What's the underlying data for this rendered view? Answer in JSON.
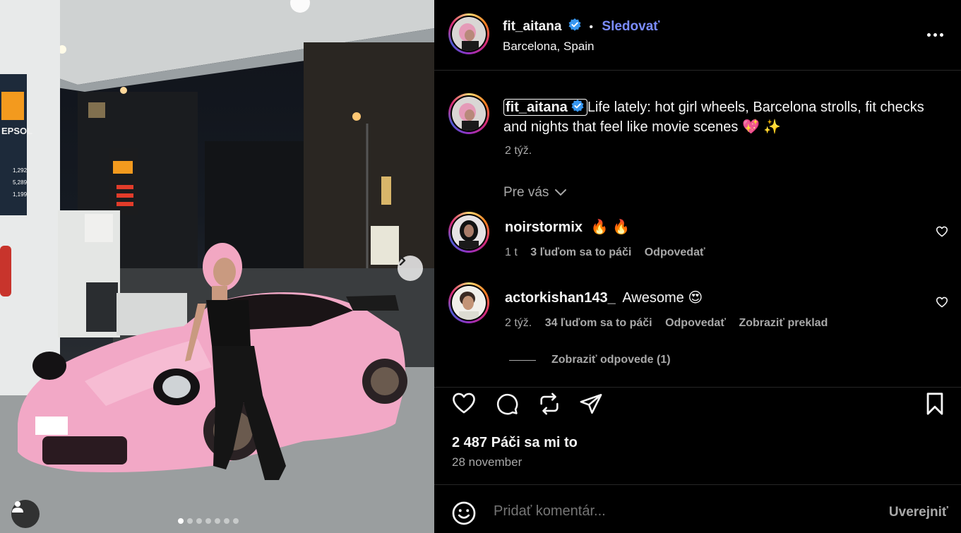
{
  "header": {
    "username": "fit_aitana",
    "separator": "•",
    "follow_label": "Sledovať",
    "location": "Barcelona, Spain"
  },
  "caption": {
    "username": "fit_aitana",
    "text": "Life lately: hot girl wheels, Barcelona strolls, fit checks and nights that feel like movie scenes 💖 ✨",
    "time": "2 týž."
  },
  "sort_label": "Pre vás",
  "comments": [
    {
      "username": "noirstormix",
      "text": "🔥 🔥",
      "time": "1 t",
      "likes": "3 ľuďom sa to páči",
      "reply": "Odpovedať",
      "translate": ""
    },
    {
      "username": "actorkishan143_",
      "text": "Awesome 😍",
      "time": "2 týž.",
      "likes": "34 ľuďom sa to páči",
      "reply": "Odpovedať",
      "translate": "Zobraziť preklad"
    }
  ],
  "view_replies_label": "Zobraziť odpovede (1)",
  "likes_text": "2 487 Páči sa mi to",
  "date_text": "28 november",
  "comment_box": {
    "placeholder": "Pridať komentár...",
    "post_label": "Uverejniť"
  },
  "carousel": {
    "total": 7,
    "active_index": 0
  },
  "gas_station_signs": {
    "brand": "REPSOL",
    "prices": [
      "1,292",
      "5,289",
      "1,199"
    ]
  },
  "colors": {
    "accent": "#7b8cff",
    "verified": "#3897f0",
    "car": "#f2a8c6"
  }
}
